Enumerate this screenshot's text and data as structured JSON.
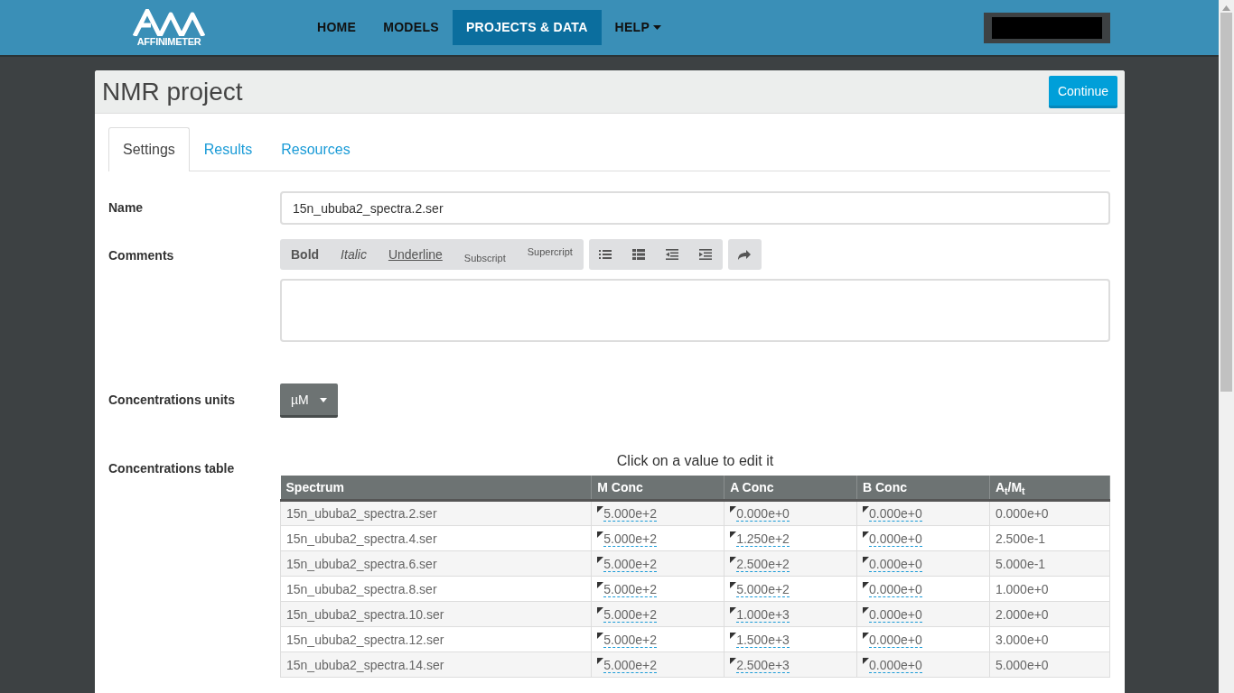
{
  "nav": {
    "logo_text": "AFFINIMETER",
    "items": [
      {
        "label": "HOME",
        "selected": false,
        "dropdown": false
      },
      {
        "label": "MODELS",
        "selected": false,
        "dropdown": false
      },
      {
        "label": "PROJECTS & DATA",
        "selected": true,
        "dropdown": false
      },
      {
        "label": "HELP",
        "selected": false,
        "dropdown": true
      }
    ]
  },
  "panel": {
    "title": "NMR project",
    "continue_button": "Continue"
  },
  "tabs": [
    {
      "label": "Settings",
      "selected": true
    },
    {
      "label": "Results",
      "selected": false
    },
    {
      "label": "Resources",
      "selected": false
    }
  ],
  "form": {
    "name_label": "Name",
    "name_value": "15n_ububa2_spectra.2.ser",
    "comments_label": "Comments",
    "toolbar": [
      {
        "buttons": [
          {
            "kind": "bold",
            "label": "Bold"
          },
          {
            "kind": "italic",
            "label": "Italic"
          },
          {
            "kind": "underline",
            "label": "Underline"
          },
          {
            "kind": "subscript",
            "label": "Subscript"
          },
          {
            "kind": "superscript",
            "label": "Supercript"
          }
        ]
      },
      {
        "buttons": [
          {
            "kind": "bullet-list"
          },
          {
            "kind": "numbered-list"
          },
          {
            "kind": "outdent"
          },
          {
            "kind": "indent"
          }
        ]
      },
      {
        "buttons": [
          {
            "kind": "redo"
          }
        ]
      }
    ],
    "units_label": "Concentrations units",
    "units_value": "µM",
    "table_label": "Concentrations table",
    "table_hint": "Click on a value to edit it"
  },
  "table": {
    "columns": [
      {
        "label": "Spectrum",
        "editable": false
      },
      {
        "label": "M Conc",
        "editable": true
      },
      {
        "label": "A Conc",
        "editable": true
      },
      {
        "label": "B Conc",
        "editable": true
      },
      {
        "label": "A$_{t}$/M$_{t}$",
        "editable": false
      }
    ],
    "rows": [
      [
        "15n_ububa2_spectra.2.ser",
        "5.000e+2",
        "0.000e+0",
        "0.000e+0",
        "0.000e+0"
      ],
      [
        "15n_ububa2_spectra.4.ser",
        "5.000e+2",
        "1.250e+2",
        "0.000e+0",
        "2.500e-1"
      ],
      [
        "15n_ububa2_spectra.6.ser",
        "5.000e+2",
        "2.500e+2",
        "0.000e+0",
        "5.000e-1"
      ],
      [
        "15n_ububa2_spectra.8.ser",
        "5.000e+2",
        "5.000e+2",
        "0.000e+0",
        "1.000e+0"
      ],
      [
        "15n_ububa2_spectra.10.ser",
        "5.000e+2",
        "1.000e+3",
        "0.000e+0",
        "2.000e+0"
      ],
      [
        "15n_ububa2_spectra.12.ser",
        "5.000e+2",
        "1.500e+3",
        "0.000e+0",
        "3.000e+0"
      ],
      [
        "15n_ububa2_spectra.14.ser",
        "5.000e+2",
        "2.500e+3",
        "0.000e+0",
        "5.000e+0"
      ]
    ]
  }
}
